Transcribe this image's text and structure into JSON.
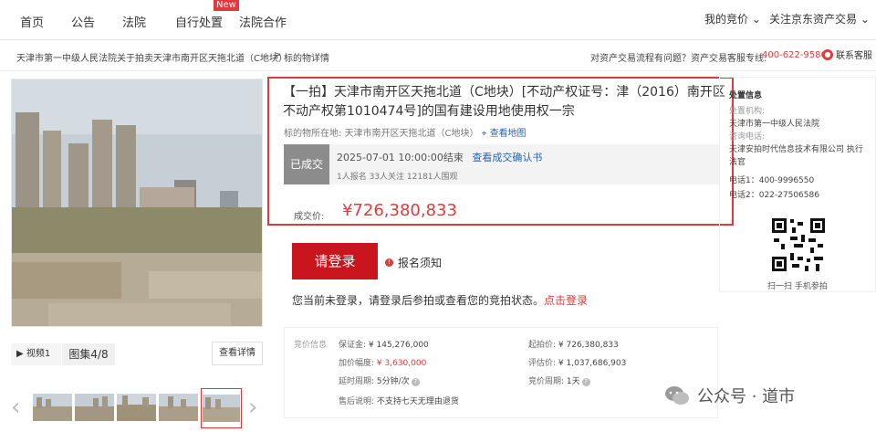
{
  "nav": {
    "items": [
      "首页",
      "公告",
      "法院",
      "自行处置",
      "法院合作"
    ],
    "new_badge": "New",
    "my_bids": "我的竞价 ⌄",
    "follow": "关注京东资产交易 ⌄"
  },
  "crumbs": {
    "item1": "天津市第一中级人民法院关于拍卖天津市南开区天拖北道（C地块）",
    "sep": ">",
    "item2": "标的物详情",
    "hotline_prefix": "对资产交易流程有问题？资产交易客服专线:",
    "hotline_number": "400-622-9586",
    "kf_label": "联系客服"
  },
  "gallery": {
    "video": "▶ 视频1",
    "album": "图集4/8",
    "detail": "查看详情",
    "prev": "‹",
    "next": "›"
  },
  "lot": {
    "title": "【一拍】天津市南开区天拖北道（C地块）[不动产权证号：津（2016）南开区不动产权第1010474号]的国有建设用地使用权一宗",
    "location_label": "标的物所在地:",
    "location": "天津市南开区天拖北道（C地块）",
    "map_link": "查看地图",
    "status": "已成交",
    "end_time": "2025-07-01 10:00:00结束",
    "confirm_link": "查看成交确认书",
    "counts": "1人报名  33人关注  12181人围观",
    "price_label": "成交价:",
    "price": "¥726,380,833"
  },
  "actions": {
    "login_button": "请登录",
    "signup_notice": "报名须知",
    "login_msg": "您当前未登录，请登录后参拍或查看您的竞拍状态。",
    "login_link": "点击登录"
  },
  "bid_info": {
    "label": "竞价信息",
    "deposit_label": "保证金:",
    "deposit": "¥ 145,276,000",
    "start_label": "起拍价:",
    "start": "¥ 726,380,833",
    "increment_label": "加价幅度:",
    "increment": "¥ 3,630,000",
    "appraisal_label": "评估价:",
    "appraisal": "¥ 1,037,686,903",
    "delay_label": "延时周期:",
    "delay": "5分钟/次",
    "cycle_label": "竞价周期:",
    "cycle": "1天",
    "aftersale_label": "售后说明:",
    "aftersale": "不支持七天无理由退货"
  },
  "disposal": {
    "title": "处置信息",
    "org_label": "处置机构:",
    "org": "天津市第一中级人民法院",
    "consult_label": "咨询电话:",
    "consult": "天津安拍时代信息技术有限公司 执行法官",
    "phone1": "电话1：400-9996550",
    "phone2": "电话2：022-27506586",
    "qr_caption": "扫一扫 手机参拍"
  },
  "watermark": {
    "text": "公众号 · 道市"
  },
  "colors": {
    "accent": "#e4393c",
    "login_button": "#c9151e",
    "link": "#2664b5",
    "status_badge": "#8c8c8c"
  }
}
